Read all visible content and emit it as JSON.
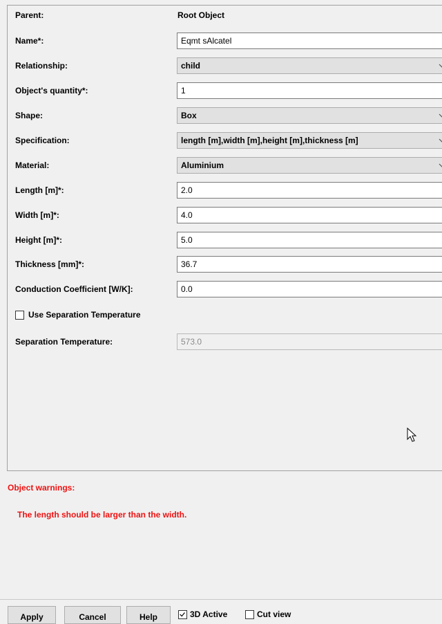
{
  "form": {
    "parent": {
      "label": "Parent:",
      "value": "Root Object"
    },
    "name": {
      "label": "Name*:",
      "value": "Eqmt sAlcatel"
    },
    "relationship": {
      "label": "Relationship:",
      "value": "child"
    },
    "quantity": {
      "label": "Object's quantity*:",
      "value": "1"
    },
    "shape": {
      "label": "Shape:",
      "value": "Box"
    },
    "specification": {
      "label": "Specification:",
      "value": "length [m],width [m],height [m],thickness [m]"
    },
    "material": {
      "label": "Material:",
      "value": "Aluminium"
    },
    "length": {
      "label": "Length [m]*:",
      "value": "2.0"
    },
    "width": {
      "label": "Width [m]*:",
      "value": "4.0"
    },
    "height": {
      "label": "Height [m]*:",
      "value": "5.0"
    },
    "thickness": {
      "label": "Thickness [mm]*:",
      "value": "36.7"
    },
    "conduction": {
      "label": "Conduction Coefficient [W/K]:",
      "value": "0.0"
    },
    "use_sep_temp": {
      "label": "Use Separation Temperature",
      "checked": false
    },
    "sep_temp": {
      "label": "Separation Temperature:",
      "value": "573.0"
    }
  },
  "warnings": {
    "title": "Object warnings:",
    "messages": [
      "The length should be larger than the width."
    ],
    "color": "#ee1111"
  },
  "footer": {
    "apply_label": "Apply",
    "cancel_label": "Cancel",
    "help_label": "Help",
    "active_3d_label": "3D Active",
    "active_3d_checked": true,
    "cut_view_label": "Cut view",
    "cut_view_checked": false
  }
}
